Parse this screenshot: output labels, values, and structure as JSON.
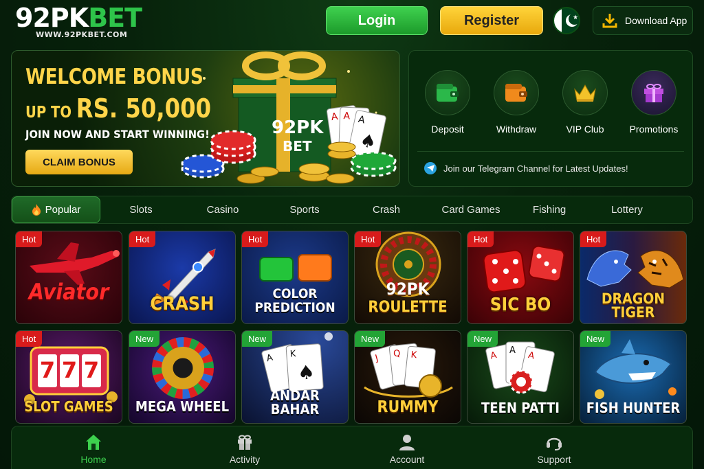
{
  "header": {
    "logo_part1": "92PK",
    "logo_part2": "BET",
    "logo_sub": "WWW.92PKBET.COM",
    "login_label": "Login",
    "register_label": "Register",
    "download_label": "Download App",
    "flag": "pakistan-flag-icon"
  },
  "banner": {
    "line1": "WELCOME BONUS",
    "line2_prefix": "UP TO ",
    "line2_amount": "RS. 50,000",
    "line3": "JOIN NOW AND START WINNING!",
    "cta_label": "CLAIM BONUS",
    "gift_brand": "92PK",
    "gift_sub": "BET"
  },
  "quick": {
    "items": [
      {
        "label": "Deposit",
        "icon": "wallet-icon"
      },
      {
        "label": "Withdraw",
        "icon": "withdraw-wallet-icon"
      },
      {
        "label": "VIP Club",
        "icon": "crown-icon"
      },
      {
        "label": "Promotions",
        "icon": "gift-icon"
      }
    ],
    "telegram_text": "Join our Telegram Channel for Latest Updates!"
  },
  "tabs": [
    {
      "label": "Popular",
      "active": true
    },
    {
      "label": "Slots"
    },
    {
      "label": "Casino"
    },
    {
      "label": "Sports"
    },
    {
      "label": "Crash"
    },
    {
      "label": "Card Games"
    },
    {
      "label": "Fishing"
    },
    {
      "label": "Lottery"
    }
  ],
  "games": [
    {
      "title": "Aviator",
      "badge": "Hot"
    },
    {
      "title": "CRASH",
      "badge": "Hot"
    },
    {
      "title1": "COLOR",
      "title2": "PREDICTION",
      "badge": "Hot"
    },
    {
      "title1": "92PK",
      "title2": "ROULETTE",
      "badge": "Hot"
    },
    {
      "title": "SIC BO",
      "badge": "Hot"
    },
    {
      "title1": "DRAGON",
      "title2": "TIGER",
      "badge": "Hot"
    },
    {
      "title": "SLOT GAMES",
      "badge": "Hot",
      "reels": "777"
    },
    {
      "title": "MEGA WHEEL",
      "badge": "New"
    },
    {
      "title1": "ANDAR",
      "title2": "BAHAR",
      "badge": "New"
    },
    {
      "title": "RUMMY",
      "badge": "New"
    },
    {
      "title": "TEEN PATTI",
      "badge": "New"
    },
    {
      "title": "FISH HUNTER",
      "badge": "New"
    }
  ],
  "bottom_nav": [
    {
      "label": "Home",
      "icon": "home-icon",
      "active": true
    },
    {
      "label": "Activity",
      "icon": "gift-box-icon"
    },
    {
      "label": "Account",
      "icon": "user-icon"
    },
    {
      "label": "Support",
      "icon": "headset-icon"
    }
  ],
  "colors": {
    "background": "#07220b",
    "accent_green": "#2ec44a",
    "accent_gold": "#ffd54a",
    "hot_badge": "#d81b1b",
    "new_badge": "#23a436"
  }
}
